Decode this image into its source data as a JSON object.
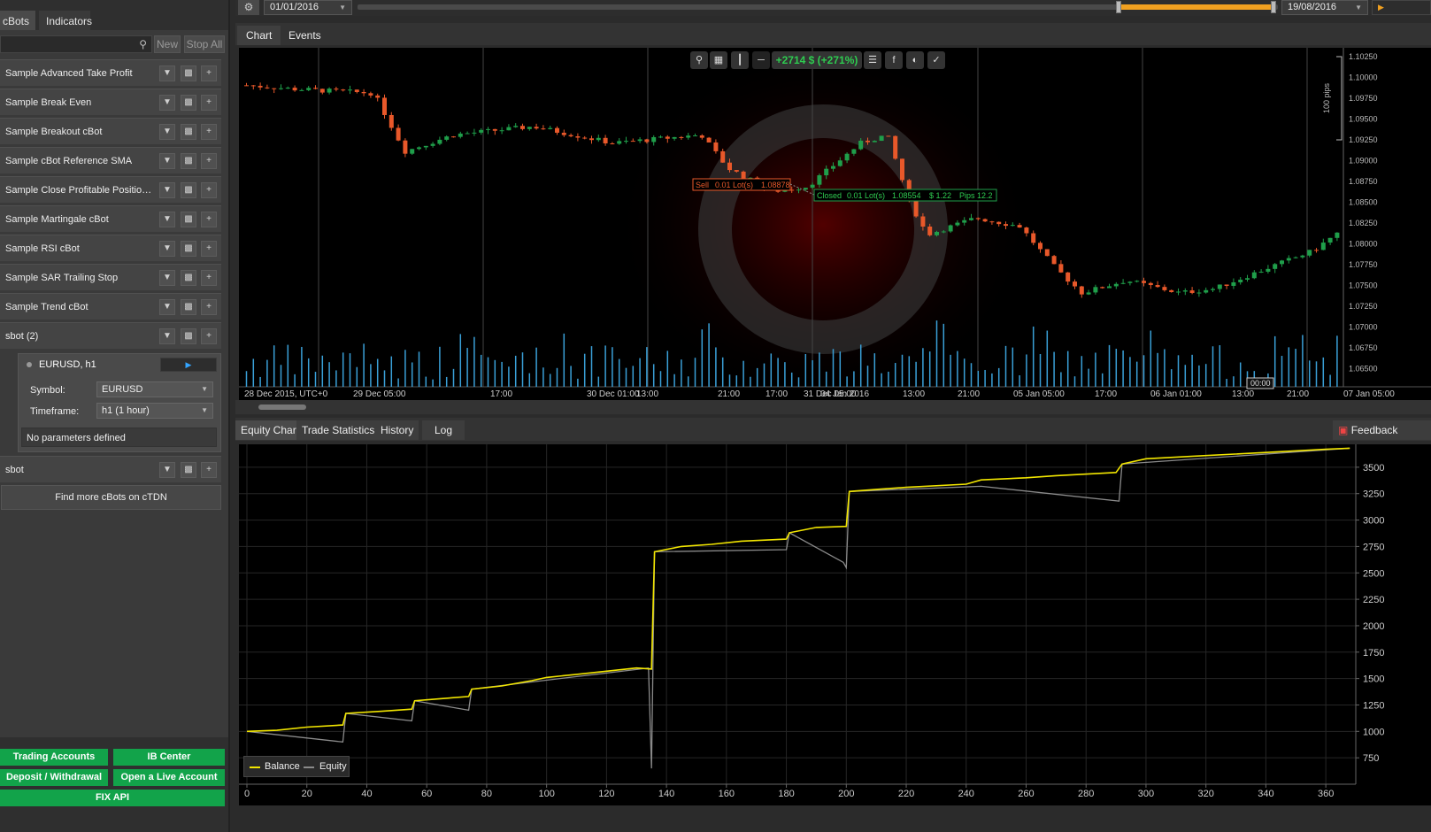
{
  "left": {
    "tabs": [
      "cBots",
      "Indicators"
    ],
    "new_label": "New",
    "stop_all_label": "Stop All",
    "bots": [
      {
        "name": "Sample Advanced Take Profit"
      },
      {
        "name": "Sample Break Even"
      },
      {
        "name": "Sample Breakout cBot"
      },
      {
        "name": "Sample cBot Reference SMA"
      },
      {
        "name": "Sample Close Profitable Positions..."
      },
      {
        "name": "Sample Martingale cBot"
      },
      {
        "name": "Sample RSI cBot"
      },
      {
        "name": "Sample SAR Trailing Stop"
      },
      {
        "name": "Sample Trend cBot"
      },
      {
        "name": "sbot (2)"
      }
    ],
    "instance": {
      "title": "EURUSD, h1",
      "symbol_label": "Symbol:",
      "symbol_value": "EURUSD",
      "timeframe_label": "Timeframe:",
      "timeframe_value": "h1 (1 hour)",
      "no_params": "No parameters defined"
    },
    "sbot": "sbot",
    "find_more": "Find more cBots on cTDN",
    "bottom_buttons": [
      "Trading Accounts",
      "IB Center",
      "Deposit / Withdrawal",
      "Open a Live Account",
      "FIX API"
    ]
  },
  "topbar": {
    "from_date": "01/01/2016",
    "to_date": "19/08/2016",
    "range_start_fraction": 0.827,
    "range_end_fraction": 0.995
  },
  "chart_tabs": [
    "Chart",
    "Events"
  ],
  "price_chart": {
    "profit_label": "+2714 $ (+271%)",
    "sell_label": "Sell",
    "sell_lots": "0.01 Lot(s)",
    "sell_price": "1.08878",
    "closed_label": "Closed",
    "closed_lots": "0.01 Lot(s)",
    "closed_price": "1.08554",
    "closed_usd": "$ 1.22",
    "closed_pips": "Pips 12.2",
    "pips_scale": "100 pips",
    "cursor_time": "00:00",
    "y_ticks": [
      "1.10250",
      "1.10000",
      "1.09750",
      "1.09500",
      "1.09250",
      "1.09000",
      "1.08750",
      "1.08500",
      "1.08250",
      "1.08000",
      "1.07750",
      "1.07500",
      "1.07250",
      "1.07000",
      "1.06750",
      "1.06500"
    ],
    "x_ticks": [
      "28 Dec 2015, UTC+0",
      "29 Dec 05:00",
      "17:00",
      "30 Dec 01:00",
      "13:00",
      "21:00",
      "31 Dec 05:00",
      "17:00",
      "04 Jan 2016",
      "13:00",
      "21:00",
      "05 Jan 05:00",
      "17:00",
      "06 Jan 01:00",
      "13:00",
      "21:00",
      "07 Jan 05:00"
    ],
    "colors": {
      "up": "#1f9e4a",
      "down": "#e8582a",
      "volume": "#3aa0d8"
    }
  },
  "bottom_tabs": [
    "Equity Chart",
    "Trade Statistics",
    "History",
    "Log"
  ],
  "feedback": "Feedback",
  "chart_data": {
    "type": "line",
    "title": "",
    "xlabel": "",
    "ylabel": "",
    "xlim": [
      0,
      370
    ],
    "ylim": [
      500,
      3700
    ],
    "x_ticks": [
      0,
      20,
      40,
      60,
      80,
      100,
      120,
      140,
      160,
      180,
      200,
      220,
      240,
      260,
      280,
      300,
      320,
      340,
      360
    ],
    "y_ticks": [
      750,
      1000,
      1250,
      1500,
      1750,
      2000,
      2250,
      2500,
      2750,
      3000,
      3250,
      3500
    ],
    "legend": "bottom-left",
    "series": [
      {
        "name": "Balance",
        "color": "#f2e600",
        "x": [
          0,
          10,
          20,
          32,
          33,
          45,
          55,
          56,
          65,
          74,
          75,
          85,
          95,
          100,
          110,
          120,
          130,
          135,
          136,
          145,
          155,
          165,
          180,
          181,
          190,
          200,
          201,
          210,
          220,
          240,
          245,
          260,
          270,
          290,
          292,
          300,
          320,
          340,
          360,
          368
        ],
        "y": [
          1000,
          1010,
          1040,
          1060,
          1170,
          1190,
          1210,
          1290,
          1310,
          1330,
          1400,
          1430,
          1480,
          1510,
          1540,
          1570,
          1600,
          1590,
          2700,
          2750,
          2770,
          2800,
          2820,
          2880,
          2930,
          2940,
          3270,
          3290,
          3310,
          3340,
          3380,
          3400,
          3420,
          3450,
          3530,
          3580,
          3610,
          3640,
          3670,
          3680
        ]
      },
      {
        "name": "Equity",
        "color": "#8a8a8a",
        "x": [
          0,
          32,
          33,
          55,
          56,
          74,
          75,
          134,
          135,
          136,
          180,
          181,
          199,
          200,
          201,
          245,
          291,
          292,
          368
        ],
        "y": [
          1000,
          900,
          1170,
          1100,
          1290,
          1200,
          1400,
          1600,
          650,
          2700,
          2720,
          2880,
          2600,
          2550,
          3270,
          3320,
          3180,
          3530,
          3680
        ]
      }
    ]
  }
}
